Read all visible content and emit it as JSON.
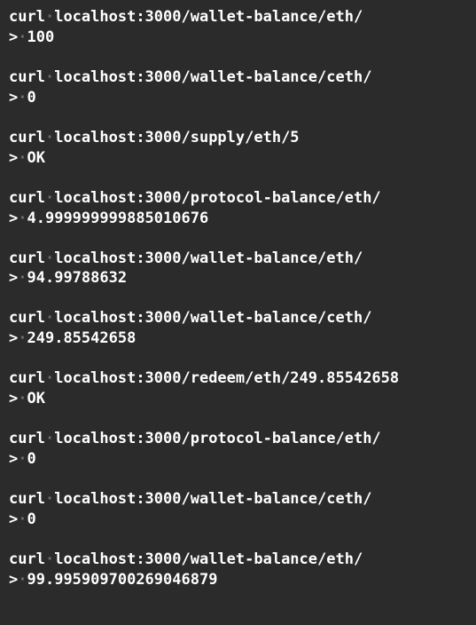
{
  "blocks": [
    {
      "cmd": "curl",
      "arg": "localhost:3000/wallet-balance/eth/",
      "outprefix": ">",
      "out": "100"
    },
    {
      "cmd": "curl",
      "arg": "localhost:3000/wallet-balance/ceth/",
      "outprefix": ">",
      "out": "0"
    },
    {
      "cmd": "curl",
      "arg": "localhost:3000/supply/eth/5",
      "outprefix": ">",
      "out": "OK"
    },
    {
      "cmd": "curl",
      "arg": "localhost:3000/protocol-balance/eth/",
      "outprefix": ">",
      "out": "4.999999999885010676"
    },
    {
      "cmd": "curl",
      "arg": "localhost:3000/wallet-balance/eth/",
      "outprefix": ">",
      "out": "94.99788632"
    },
    {
      "cmd": "curl",
      "arg": "localhost:3000/wallet-balance/ceth/",
      "outprefix": ">",
      "out": "249.85542658"
    },
    {
      "cmd": "curl",
      "arg": "localhost:3000/redeem/eth/249.85542658",
      "outprefix": ">",
      "out": "OK"
    },
    {
      "cmd": "curl",
      "arg": "localhost:3000/protocol-balance/eth/",
      "outprefix": ">",
      "out": "0"
    },
    {
      "cmd": "curl",
      "arg": "localhost:3000/wallet-balance/ceth/",
      "outprefix": ">",
      "out": "0"
    },
    {
      "cmd": "curl",
      "arg": "localhost:3000/wallet-balance/eth/",
      "outprefix": ">",
      "out": "99.995909700269046879"
    }
  ],
  "dot": "·"
}
